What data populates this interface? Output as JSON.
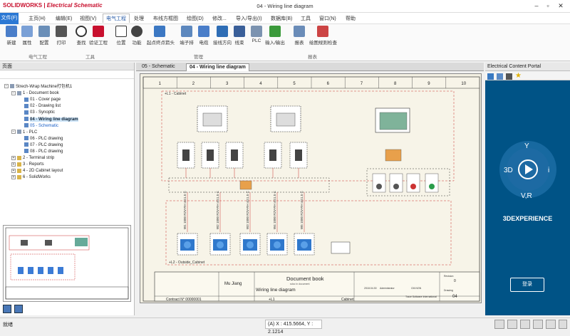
{
  "app": {
    "brand": "SOLIDWORKS",
    "brand_sub": "Electrical Schematic",
    "window_title": "04 - Wiring line diagram"
  },
  "menu": {
    "file": "文件(F)",
    "items": [
      "主页(H)",
      "编辑(E)",
      "视图(V)",
      "电气工程",
      "处理",
      "布线方框图",
      "绘图(D)",
      "修改...",
      "导入/导出(I)",
      "数据库(B)",
      "工具",
      "窗口(N)",
      "帮助"
    ]
  },
  "ribbon": {
    "buttons": [
      "新建",
      "属性",
      "配置",
      "打印",
      "查找",
      "验证工程",
      "位置",
      "功能",
      "起点终点箭头",
      "端子排",
      "电缆",
      "接线方向",
      "线束",
      "PLC",
      "输入/输出",
      "报表",
      "绘图规则检查"
    ],
    "groups": [
      "电气工程",
      "工具",
      "管理",
      "报表"
    ]
  },
  "left_panel": {
    "title": "页面",
    "tree": [
      {
        "label": "Strech-Wrap Machine打包机1",
        "level": 0,
        "type": "root",
        "expanded": true
      },
      {
        "label": "1 - Document book",
        "level": 1,
        "type": "book",
        "expanded": true
      },
      {
        "label": "01 - Cover page",
        "level": 2,
        "type": "doc"
      },
      {
        "label": "02 - Drawing list",
        "level": 2,
        "type": "doc"
      },
      {
        "label": "03 - Synoptic",
        "level": 2,
        "type": "doc"
      },
      {
        "label": "04 - Wiring line diagram",
        "level": 2,
        "type": "doc",
        "selected": true
      },
      {
        "label": "05 - Schematic",
        "level": 2,
        "type": "doc",
        "blue": true
      },
      {
        "label": "1 - PLC",
        "level": 1,
        "type": "book",
        "expanded": true
      },
      {
        "label": "06 - PLC drawing",
        "level": 2,
        "type": "doc"
      },
      {
        "label": "07 - PLC drawing",
        "level": 2,
        "type": "doc"
      },
      {
        "label": "08 - PLC drawing",
        "level": 2,
        "type": "doc"
      },
      {
        "label": "2 - Terminal strip",
        "level": 1,
        "type": "fold"
      },
      {
        "label": "3 - Reports",
        "level": 1,
        "type": "fold"
      },
      {
        "label": "4 - 2D Cabinet layout",
        "level": 1,
        "type": "fold"
      },
      {
        "label": "6 - SolidWorks",
        "level": 1,
        "type": "fold"
      }
    ]
  },
  "tabs": [
    {
      "label": "05 - Schematic",
      "active": false
    },
    {
      "label": "04 - Wiring line diagram",
      "active": true
    }
  ],
  "drawing": {
    "columns": [
      "1",
      "2",
      "3",
      "4",
      "5",
      "6",
      "7",
      "8",
      "9",
      "10"
    ],
    "cabinet_label": "+L1 - Cabinet",
    "outside_label": "+L2 - Outside_Cabinet",
    "cable_labels": [
      "W1 1000 R2V-RH 4G1.5 C",
      "W2 1000 R2V-RH 4G1.5 C",
      "W3 1000 R2V-RH 4G1.5 C",
      "W4 1000 R2V-RH 4G1.5 C",
      "W5 1000 R2V-RH 4G1.5 C"
    ],
    "title_block": {
      "author": "Mu Jiang",
      "doc_book": "Document book",
      "subtitle": "sdoc in document",
      "diagram": "Wiring line diagram",
      "contract": "Contract N° 00000001",
      "location": "+L1",
      "cabinet": "Cabinet",
      "company": "Trace Software International",
      "sheet_no": "04",
      "revision": "0",
      "date": "2018.04.30",
      "admin": "Administrator",
      "cm": "CM.NGN",
      "revision_label": "Revision",
      "drawing_label": "Drawing"
    }
  },
  "right_panel": {
    "title": "Electrical Content Portal",
    "brand": "3DEXPERIENCE",
    "login": "登录",
    "compass": {
      "top": "Y",
      "left": "3D",
      "right": "i",
      "bottom": "V,R"
    },
    "bg_color": "#005386"
  },
  "status": {
    "left": "就绪",
    "coords": "(A) X : 415.5664, Y : 2.1214"
  }
}
